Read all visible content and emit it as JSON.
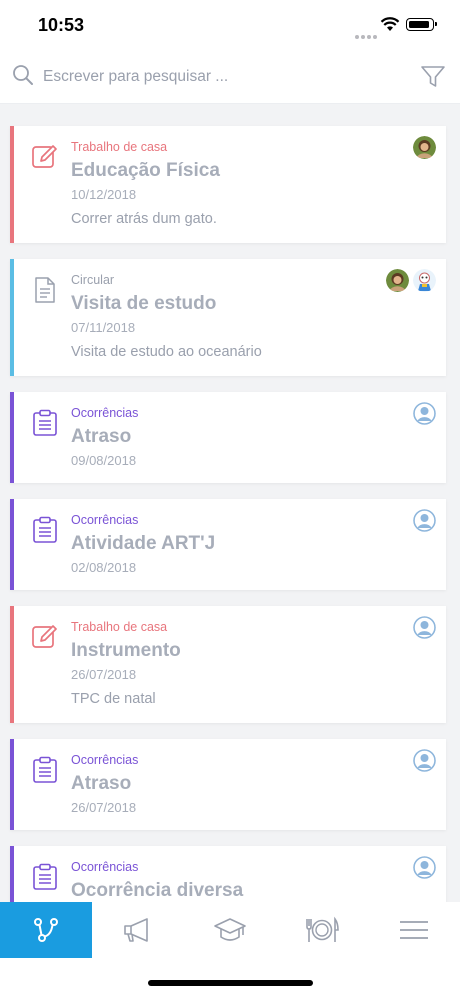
{
  "status_bar": {
    "time": "10:53"
  },
  "search": {
    "placeholder": "Escrever para pesquisar ..."
  },
  "items": [
    {
      "category": "Trabalho de casa",
      "title": "Educação Física",
      "date": "10/12/2018",
      "description": "Correr atrás dum gato."
    },
    {
      "category": "Circular",
      "title": "Visita de estudo",
      "date": "07/11/2018",
      "description": "Visita de estudo ao oceanário"
    },
    {
      "category": "Ocorrências",
      "title": "Atraso",
      "date": "09/08/2018"
    },
    {
      "category": "Ocorrências",
      "title": "Atividade ART'J",
      "date": "02/08/2018"
    },
    {
      "category": "Trabalho de casa",
      "title": "Instrumento",
      "date": "26/07/2018",
      "description": "TPC de natal"
    },
    {
      "category": "Ocorrências",
      "title": "Atraso",
      "date": "26/07/2018"
    },
    {
      "category": "Ocorrências",
      "title": "Ocorrência diversa",
      "date": ""
    }
  ],
  "tabs": [
    "timeline-icon",
    "megaphone-icon",
    "graduation-cap-icon",
    "meal-icon",
    "menu-icon"
  ],
  "colors": {
    "homework": "#e8757d",
    "circular": "#5bbde4",
    "occurrence": "#7a53d6",
    "active_tab": "#1a9ce0"
  }
}
